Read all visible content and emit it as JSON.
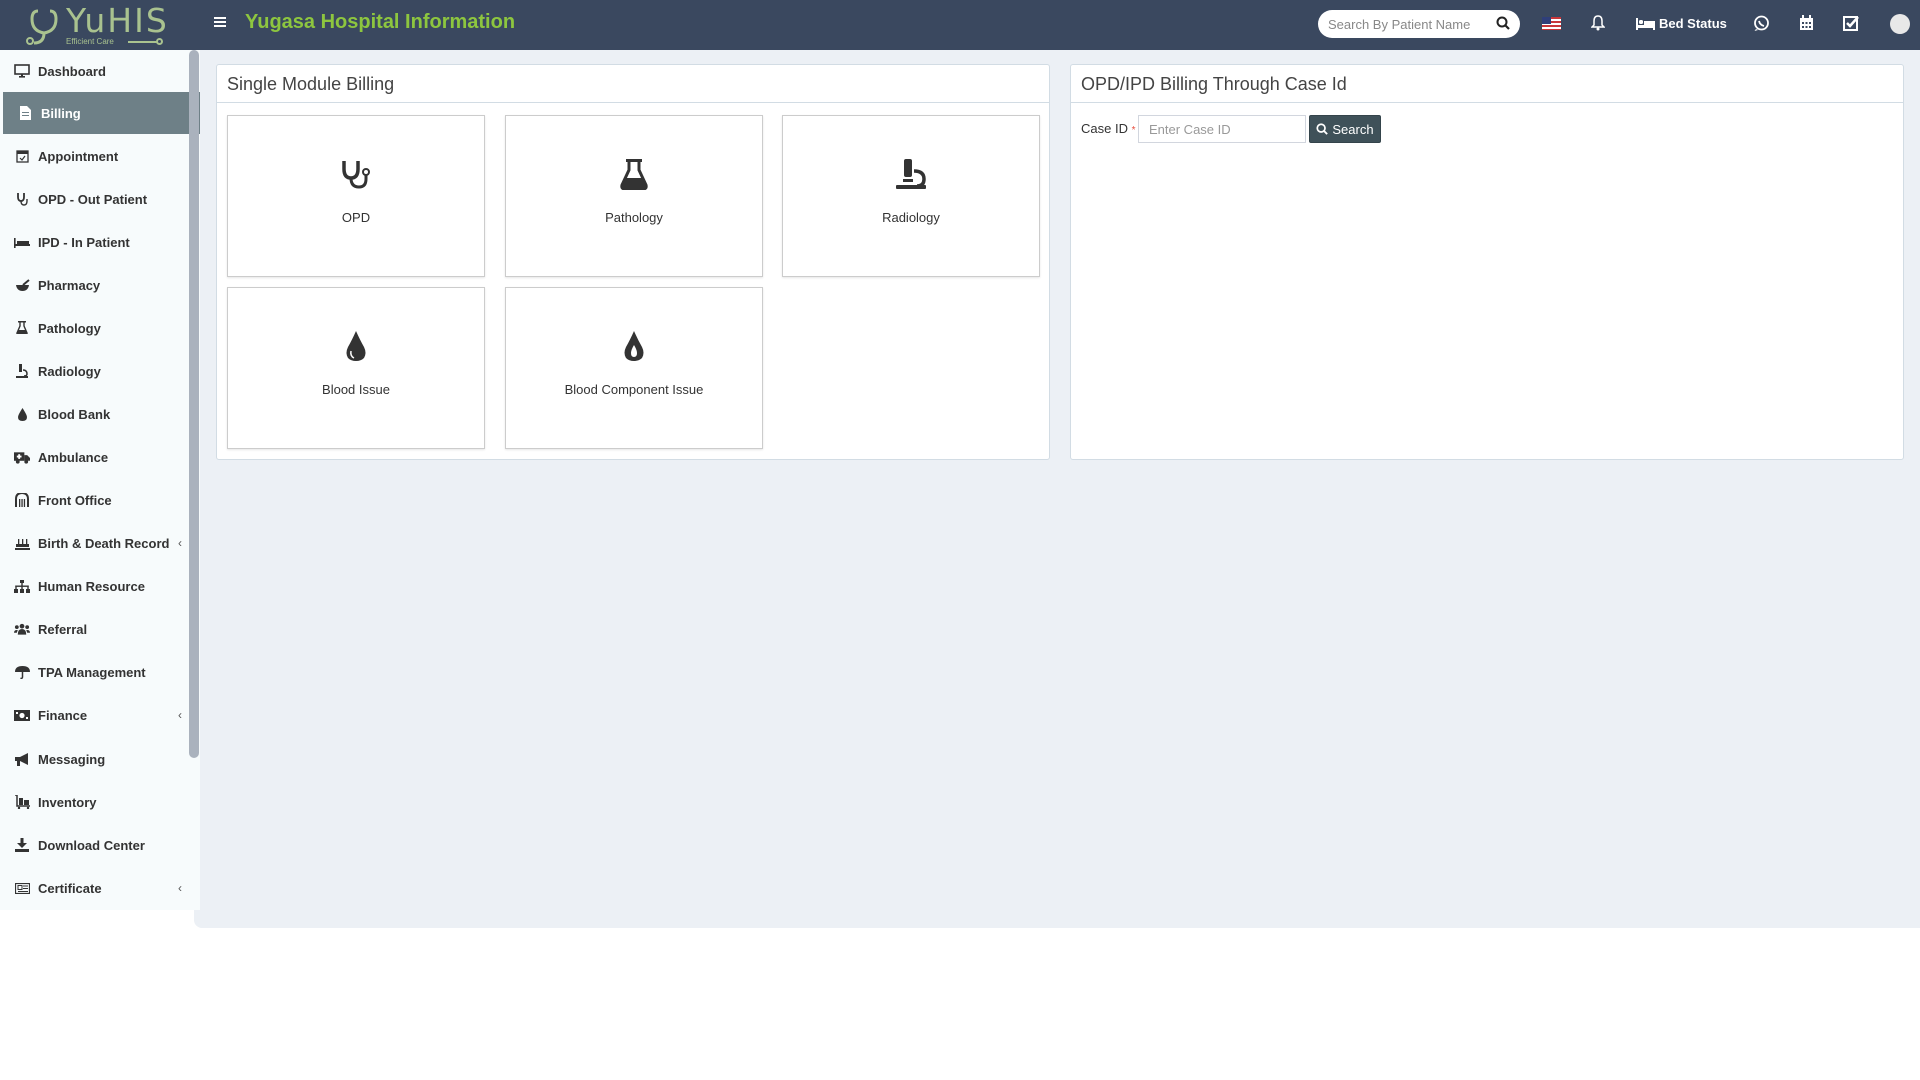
{
  "header": {
    "logo_text": "YuHIS",
    "logo_tagline": "Efficient Care",
    "app_title": "Yugasa Hospital Information",
    "search_placeholder": "Search By Patient Name",
    "bed_status_label": "Bed Status",
    "colors": {
      "background": "#3a485f",
      "title": "#8dc63f",
      "logo": "#a9c28f"
    }
  },
  "sidebar": {
    "active_item": "Billing",
    "items": [
      {
        "label": "Dashboard",
        "icon": "monitor-icon",
        "has_submenu": false
      },
      {
        "label": "Billing",
        "icon": "file-invoice-icon",
        "has_submenu": false
      },
      {
        "label": "Appointment",
        "icon": "calendar-check-icon",
        "has_submenu": false
      },
      {
        "label": "OPD - Out Patient",
        "icon": "stethoscope-icon",
        "has_submenu": false
      },
      {
        "label": "IPD - In Patient",
        "icon": "procedures-icon",
        "has_submenu": false
      },
      {
        "label": "Pharmacy",
        "icon": "mortar-pestle-icon",
        "has_submenu": false
      },
      {
        "label": "Pathology",
        "icon": "flask-icon",
        "has_submenu": false
      },
      {
        "label": "Radiology",
        "icon": "microscope-icon",
        "has_submenu": false
      },
      {
        "label": "Blood Bank",
        "icon": "tint-icon",
        "has_submenu": false
      },
      {
        "label": "Ambulance",
        "icon": "ambulance-icon",
        "has_submenu": false
      },
      {
        "label": "Front Office",
        "icon": "dungeon-icon",
        "has_submenu": false
      },
      {
        "label": "Birth & Death Record",
        "icon": "birthday-cake-icon",
        "has_submenu": true
      },
      {
        "label": "Human Resource",
        "icon": "sitemap-icon",
        "has_submenu": false
      },
      {
        "label": "Referral",
        "icon": "users-icon",
        "has_submenu": false
      },
      {
        "label": "TPA Management",
        "icon": "umbrella-icon",
        "has_submenu": false
      },
      {
        "label": "Finance",
        "icon": "money-bill-icon",
        "has_submenu": true
      },
      {
        "label": "Messaging",
        "icon": "bullhorn-icon",
        "has_submenu": false
      },
      {
        "label": "Inventory",
        "icon": "luggage-cart-icon",
        "has_submenu": false
      },
      {
        "label": "Download Center",
        "icon": "download-icon",
        "has_submenu": false
      },
      {
        "label": "Certificate",
        "icon": "newspaper-icon",
        "has_submenu": true
      }
    ]
  },
  "single_module": {
    "title": "Single Module Billing",
    "tiles": [
      {
        "label": "OPD",
        "icon": "stethoscope-icon"
      },
      {
        "label": "Pathology",
        "icon": "flask-icon"
      },
      {
        "label": "Radiology",
        "icon": "microscope-icon"
      },
      {
        "label": "Blood Issue",
        "icon": "tint-icon"
      },
      {
        "label": "Blood Component Issue",
        "icon": "burn-icon"
      }
    ]
  },
  "case_billing": {
    "title": "OPD/IPD Billing Through Case Id",
    "case_id_label": "Case ID",
    "required_mark": "*",
    "case_id_placeholder": "Enter Case ID",
    "case_id_value": "",
    "search_label": "Search"
  }
}
